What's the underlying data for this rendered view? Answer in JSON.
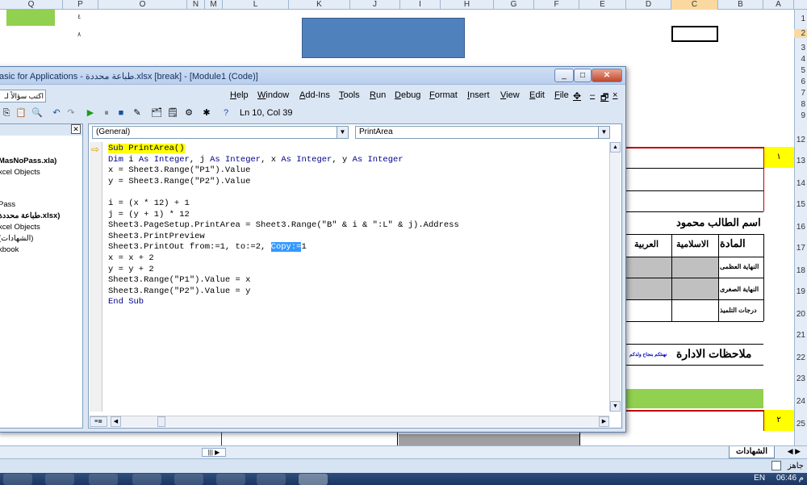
{
  "excel": {
    "col_headers": [
      "Q",
      "P",
      "O",
      "N",
      "M",
      "L",
      "K",
      "J",
      "I",
      "H",
      "G",
      "F",
      "E",
      "D",
      "C",
      "B",
      "A"
    ],
    "active_col": "C",
    "row_headers": [
      "1",
      "2",
      "3",
      "4",
      "5",
      "6",
      "7",
      "8",
      "9",
      "12",
      "13",
      "14",
      "15",
      "16",
      "17",
      "18",
      "19",
      "20",
      "21",
      "22",
      "23",
      "24",
      "25"
    ],
    "small_numbers": [
      "٤",
      "٨"
    ],
    "row_number_1": "١",
    "row_number_2": "٢",
    "student_label": "اسم الطالب  محمود",
    "table_headers": [
      "المادة",
      "الاسلامية",
      "العربية"
    ],
    "row_labels": [
      "النهاية العظمى",
      "النهاية الصغرى",
      "درجات التلميذ"
    ],
    "admin_notes": "ملاحظات الادارة",
    "small_note": "نهنئكم بنجاح ولدكم",
    "sheet_tab": "الشهادات",
    "status_left": "جاهز",
    "tray_lang": "EN",
    "tray_time": "06:46 م"
  },
  "vba": {
    "title": "asic for Applications - طباعة محددة.xlsx [break] - [Module1 (Code)]",
    "window_buttons": [
      "_",
      "□",
      "✕"
    ],
    "menu": [
      "Help",
      "Window",
      "Add-Ins",
      "Tools",
      "Run",
      "Debug",
      "Format",
      "Insert",
      "View",
      "Edit",
      "File"
    ],
    "help_box_placeholder": "اكتب سؤالاً لـ",
    "position": "Ln 10, Col 39",
    "project": {
      "items": [
        {
          "text": "MasNoPass.xla)",
          "bold": true
        },
        {
          "text": "xcel Objects",
          "bold": false
        },
        {
          "text": "Pass",
          "bold": false
        },
        {
          "text": "طباعة محددة.xlsx)",
          "bold": true
        },
        {
          "text": "xcel Objects",
          "bold": false
        },
        {
          "text": "(الشهادات)",
          "bold": false
        },
        {
          "text": "kbook",
          "bold": false
        }
      ]
    },
    "combo_left": "(General)",
    "combo_right": "PrintArea",
    "code_lines": [
      "Sub PrintArea()",
      "Dim i As Integer, j As Integer, x As Integer, y As Integer",
      "x = Sheet3.Range(\"P1\").Value",
      "y = Sheet3.Range(\"P2\").Value",
      "",
      "i = (x * 12) + 1",
      "j = (y + 1) * 12",
      "Sheet3.PageSetup.PrintArea = Sheet3.Range(\"B\" & i & \":L\" & j).Address",
      "Sheet3.PrintPreview",
      "Sheet3.PrintOut from:=1, to:=2, Copy:=1",
      "x = x + 2",
      "y = y + 2",
      "Sheet3.Range(\"P1\").Value = x",
      "Sheet3.Range(\"P2\").Value = y",
      "End Sub"
    ]
  }
}
